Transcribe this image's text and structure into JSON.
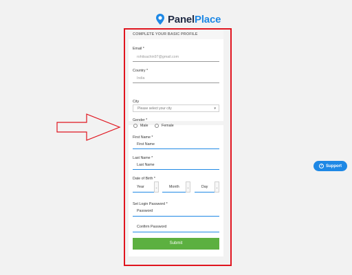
{
  "logo": {
    "part1": "Panel",
    "part2": "Place"
  },
  "form": {
    "header": "COMPLETE YOUR BASIC PROFILE",
    "email": {
      "label": "Email *",
      "value": "rohitsachin97@gmail.com"
    },
    "country": {
      "label": "Country *",
      "value": "India"
    },
    "city": {
      "label": "City",
      "placeholder": "Please select your city"
    },
    "gender": {
      "label": "Gender *",
      "options": [
        "Male",
        "Female"
      ]
    },
    "first_name": {
      "label": "First Name *",
      "placeholder": "First Name"
    },
    "last_name": {
      "label": "Last Name *",
      "placeholder": "Last Name"
    },
    "dob": {
      "label": "Date of Birth *",
      "year": "Year",
      "month": "Month",
      "day": "Day"
    },
    "password": {
      "label": "Set Login Password *",
      "placeholder": "Password"
    },
    "confirm_password": {
      "placeholder": "Confirm Password"
    },
    "submit_label": "Submit"
  },
  "support": {
    "label": "Support"
  },
  "colors": {
    "brand_dark": "#1f2a44",
    "brand_blue": "#1e88e5",
    "submit_green": "#5cb040",
    "annotation_red": "#e0141e"
  }
}
